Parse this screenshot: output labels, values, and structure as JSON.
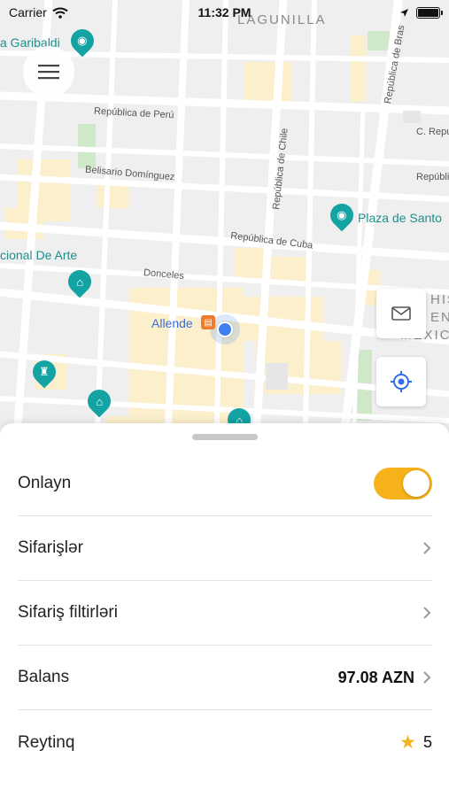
{
  "status_bar": {
    "carrier": "Carrier",
    "time": "11:32 PM"
  },
  "map": {
    "labels": {
      "lagunilla": "LAGUNILLA",
      "garibaldi": "a Garibaldi",
      "republica_peru": "República de Perú",
      "republica_brasil": "República de Bras",
      "c_republica": "C. Repu",
      "republica_chile": "República de Chile",
      "belisario": "Belisario Domínguez",
      "republica_right": "República de",
      "plaza_santo": "Plaza de Santo",
      "republica_cuba": "República de Cuba",
      "nacional_arte": "cional De Arte",
      "donceles": "Donceles",
      "allende": "Allende",
      "historic_1": "HIST",
      "historic_2": "ENT",
      "historic_3": "MEXIC"
    },
    "icons": [
      "camera-icon",
      "museum-icon",
      "monument-icon",
      "metro-icon"
    ]
  },
  "buttons": {
    "menu_icon": "hamburger-icon",
    "mail_icon": "mail-icon",
    "locate_icon": "crosshair-icon"
  },
  "sheet": {
    "rows": [
      {
        "label": "Onlayn",
        "toggle_on": true
      },
      {
        "label": "Sifarişlər"
      },
      {
        "label": "Sifariş filtirləri"
      },
      {
        "label": "Balans",
        "value": "97.08 AZN"
      },
      {
        "label": "Reytinq",
        "value": "5"
      }
    ]
  },
  "colors": {
    "accent": "#f5b21b",
    "map_bg": "#efefef",
    "poi": "#13a3a3",
    "location_dot": "#3f7ff0"
  }
}
